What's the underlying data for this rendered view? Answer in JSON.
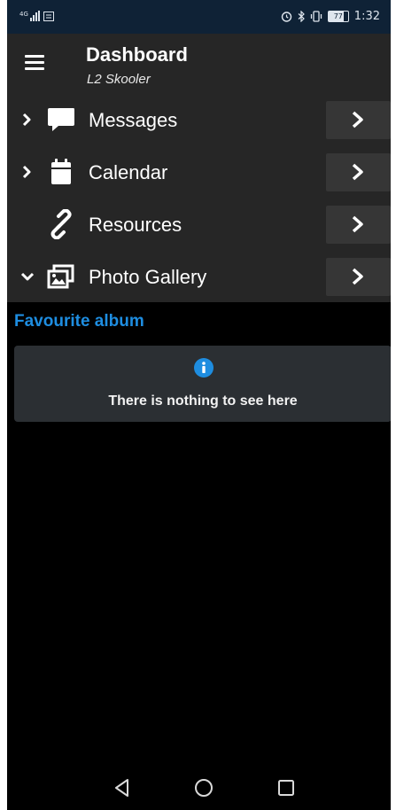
{
  "status_bar": {
    "network_label": "4G",
    "battery_level": "77",
    "time": "1:32",
    "icons": [
      "signal-icon",
      "message-icon",
      "alarm-icon",
      "bluetooth-icon",
      "vibrate-icon",
      "battery-icon"
    ]
  },
  "header": {
    "title": "Dashboard",
    "subtitle": "L2 Skooler",
    "menu_icon": "hamburger-menu-icon"
  },
  "menu": {
    "items": [
      {
        "label": "Messages",
        "icon": "chat-bubble-icon",
        "expander": "collapsed"
      },
      {
        "label": "Calendar",
        "icon": "calendar-icon",
        "expander": "collapsed"
      },
      {
        "label": "Resources",
        "icon": "link-icon",
        "expander": "none"
      },
      {
        "label": "Photo Gallery",
        "icon": "photo-gallery-icon",
        "expander": "expanded"
      }
    ]
  },
  "favourite_album": {
    "title": "Favourite album",
    "empty_message": "There is nothing to see here",
    "info_icon": "info-icon"
  },
  "navbar": {
    "icons": [
      "back-icon",
      "home-icon",
      "recents-icon"
    ]
  },
  "colors": {
    "accent": "#1e8de0",
    "header_bg": "#262626",
    "status_bar_bg": "#0f2236",
    "card_bg": "#2b2f33"
  }
}
